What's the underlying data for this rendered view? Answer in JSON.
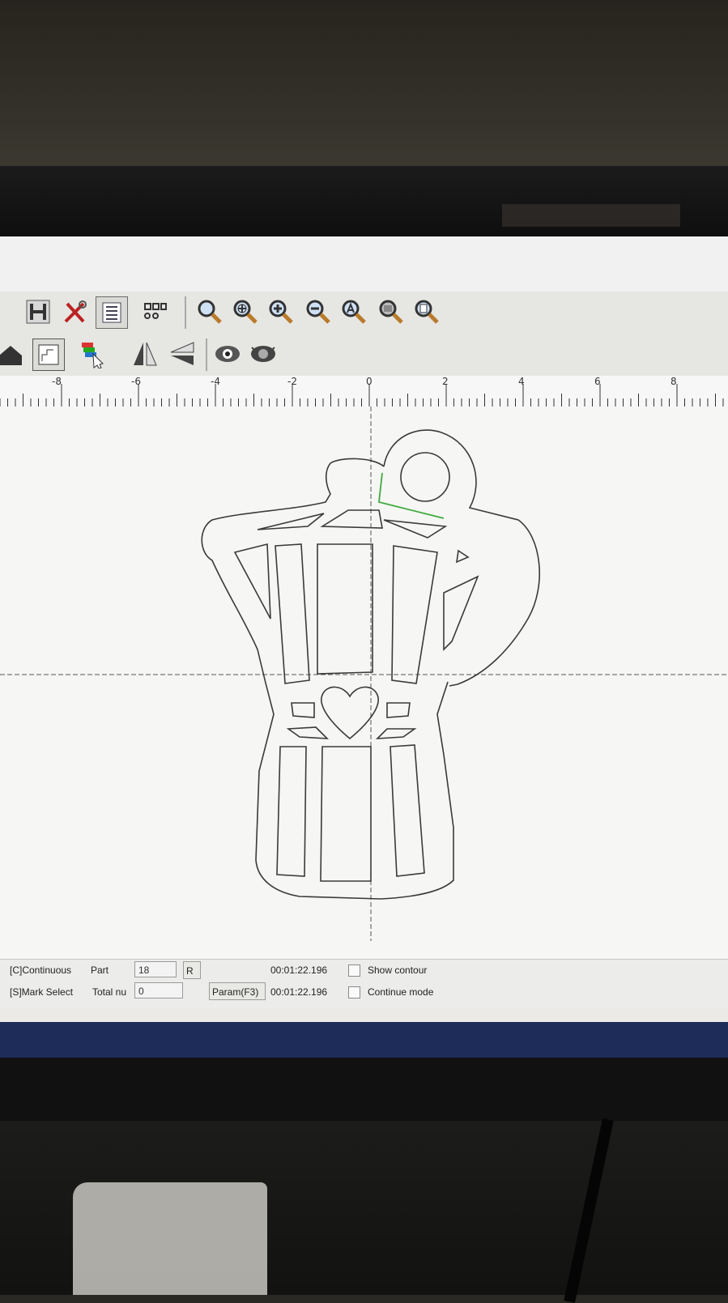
{
  "toolbar_row1": {
    "icons": [
      "h-layout-icon",
      "tools-icon",
      "list-settings-icon",
      "array-icon",
      "zoom-icon",
      "zoom-all-icon",
      "zoom-in-icon",
      "zoom-out-icon",
      "zoom-auto-icon",
      "zoom-select-icon",
      "zoom-page-icon"
    ]
  },
  "toolbar_row2": {
    "icons": [
      "home-icon",
      "layer-graph-icon",
      "color-layer-icon",
      "mirror-horizontal-icon",
      "mirror-vertical-icon",
      "view-icon",
      "view-all-icon"
    ]
  },
  "ruler": {
    "labels": [
      "-8",
      "-6",
      "-4",
      "-2",
      "0",
      "2",
      "4",
      "6",
      "8"
    ]
  },
  "status": {
    "continuous_label": "[C]Continuous",
    "part_label": "Part",
    "part_value": "18",
    "r_button": "R",
    "time_1": "00:01:22.196",
    "show_contour_label": "Show contour",
    "mark_select_label": "[S]Mark Select",
    "total_label": "Total nu",
    "total_value": "0",
    "param_button": "Param(F3)",
    "time_2": "00:01:22.196",
    "continue_mode_label": "Continue mode"
  },
  "colors": {
    "outline": "#3a3a3a",
    "selected_path": "#3faa3f",
    "crosshair": "#555555",
    "taskbar": "#1d2c58"
  }
}
